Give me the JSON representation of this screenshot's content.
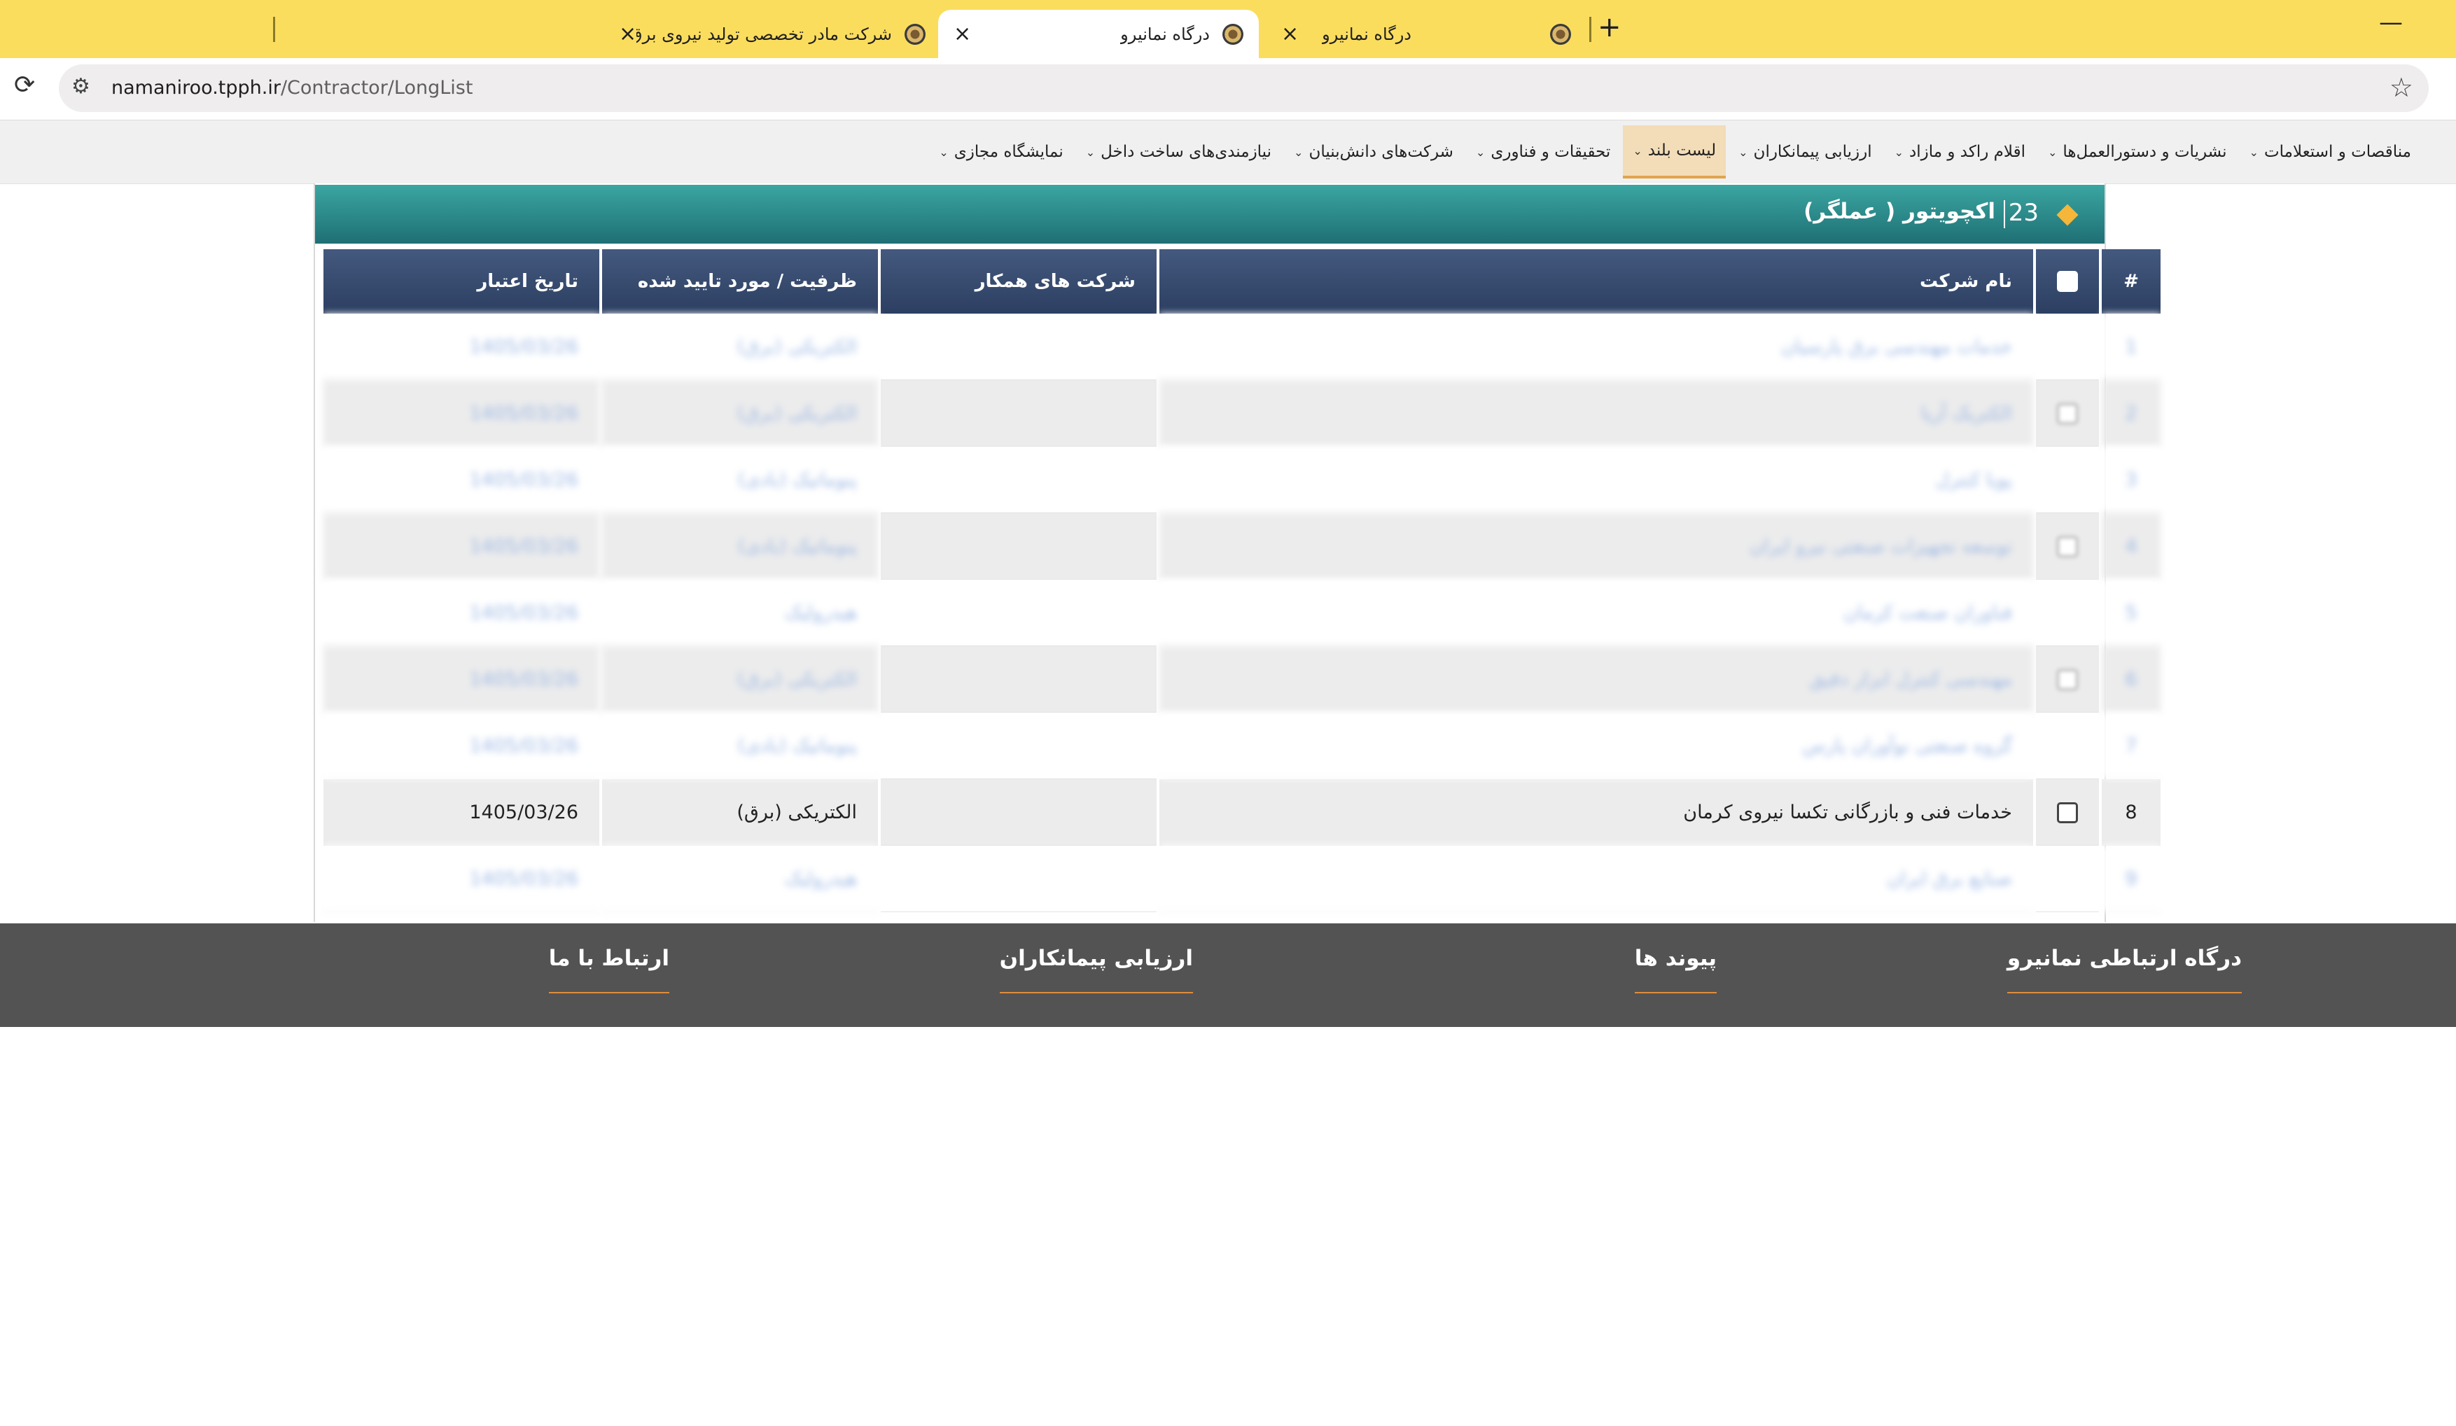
{
  "browser": {
    "tabs": [
      {
        "title": "شرکت مادر تخصصی تولید نیروی برق",
        "active": false
      },
      {
        "title": "درگاه نمانیرو",
        "active": true
      },
      {
        "title": "درگاه نمانیرو",
        "active": false
      }
    ],
    "new_tab_icon": "+",
    "close_icon": "×",
    "minimize_icon": "—",
    "reload_icon": "⟳",
    "site_info_icon": "⚙",
    "bookmark_icon": "☆",
    "url_host": "namaniroo.tpph.ir",
    "url_path": "/Contractor/LongList"
  },
  "nav": {
    "items": [
      {
        "label": "نمایشگاه مجازی",
        "active": false
      },
      {
        "label": "نیازمندی‌های ساخت داخل",
        "active": false
      },
      {
        "label": "شرکت‌های دانش‌بنیان",
        "active": false
      },
      {
        "label": "تحقیقات و فناوری",
        "active": false
      },
      {
        "label": "لیست بلند",
        "active": true
      },
      {
        "label": "ارزیابی پیمانکاران",
        "active": false
      },
      {
        "label": "اقلام راکد و مازاد",
        "active": false
      },
      {
        "label": "نشریات و دستورالعمل‌ها",
        "active": false
      },
      {
        "label": "مناقصات و استعلامات",
        "active": false
      }
    ],
    "chevron": "⌄"
  },
  "panel": {
    "count": "23",
    "title": "اکچویتور ( عملگر)"
  },
  "table": {
    "headers": {
      "num": "#",
      "company": "نام شرکت",
      "partners": "شرکت های همکار",
      "capacity": "ظرفیت / مورد تایید شده",
      "validity": "تاریخ اعتبار"
    },
    "rows": [
      {
        "num": "1",
        "company": "خدمات مهندسی برق پارسیان",
        "partners": "",
        "capacity": "الکتریکی (برق)",
        "date": "1405/03/26",
        "blurred": true
      },
      {
        "num": "2",
        "company": "الکتریک آریا",
        "partners": "",
        "capacity": "الکتریکی (برق)",
        "date": "1405/03/26",
        "blurred": true
      },
      {
        "num": "3",
        "company": "پویا کنترل",
        "partners": "",
        "capacity": "پنوماتیک (بادی)",
        "date": "1405/03/26",
        "blurred": true
      },
      {
        "num": "4",
        "company": "توسعه تجهیزات صنعتی نیرو ایران",
        "partners": "",
        "capacity": "پنوماتیک (بادی)",
        "date": "1405/03/26",
        "blurred": true
      },
      {
        "num": "5",
        "company": "فناوران صنعت کرمان",
        "partners": "",
        "capacity": "هیدرولیک",
        "date": "1405/03/26",
        "blurred": true
      },
      {
        "num": "6",
        "company": "مهندسی کنترل ابزار دقیق",
        "partners": "",
        "capacity": "الکتریکی (برق)",
        "date": "1405/03/26",
        "blurred": true
      },
      {
        "num": "7",
        "company": "گروه صنعتی نوآوران پارس",
        "partners": "",
        "capacity": "پنوماتیک (بادی)",
        "date": "1405/03/26",
        "blurred": true
      },
      {
        "num": "8",
        "company": "خدمات فنی و بازرگانی تکسا نیروی کرمان",
        "partners": "",
        "capacity": "الکتریکی (برق)",
        "date": "1405/03/26",
        "blurred": false
      },
      {
        "num": "9",
        "company": "صنایع برق ایران",
        "partners": "",
        "capacity": "هیدرولیک",
        "date": "1405/03/26",
        "blurred": true
      }
    ]
  },
  "footer": {
    "columns": [
      {
        "title": "درگاه ارتباطی نمانیرو"
      },
      {
        "title": "پیوند ها"
      },
      {
        "title": "ارزیابی پیمانکاران"
      },
      {
        "title": "ارتباط با ما"
      }
    ]
  },
  "colors": {
    "tab_strip": "#fbdd5e",
    "panel_header": "#2a8a8a",
    "table_header": "#34496e",
    "accent": "#f5b63a",
    "footer": "#535353",
    "footer_underline": "#e08d3c"
  }
}
